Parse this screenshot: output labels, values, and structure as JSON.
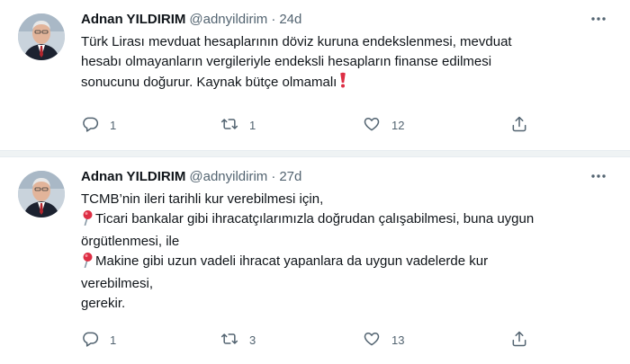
{
  "tweets": [
    {
      "display_name": "Adnan YILDIRIM",
      "handle": "@adnyildirim",
      "separator": "·",
      "time": "24d",
      "text_lines": [
        "Türk Lirası mevduat hesaplarının döviz kuruna endekslenmesi, mevduat",
        "hesabı olmayanların vergileriyle endeksli hesapların finanse edilmesi",
        "sonucunu doğurur. Kaynak bütçe olmamalı"
      ],
      "emoji_icon": "red-exclamation-icon",
      "replies": "1",
      "retweets": "1",
      "likes": "12"
    },
    {
      "display_name": "Adnan YILDIRIM",
      "handle": "@adnyildirim",
      "separator": "·",
      "time": "27d",
      "text_lines": [
        "TCMB’nin ileri tarihli kur verebilmesi için,",
        "Ticari bankalar gibi ihracatçılarımızla doğrudan çalışabilmesi, buna uygun",
        "örgütlenmesi, ile",
        "Makine gibi uzun vadeli ihracat yapanlara da uygun vadelerde kur",
        "verebilmesi,",
        "gerekir."
      ],
      "bullet_icon": "round-pushpin-icon",
      "replies": "1",
      "retweets": "3",
      "likes": "13"
    }
  ],
  "colors": {
    "text": "#0f1419",
    "secondary": "#536471",
    "separator_bg": "#eff3f4",
    "emoji_red": "#dd2e44"
  },
  "icons": [
    "avatar",
    "more-icon",
    "reply-icon",
    "retweet-icon",
    "like-icon",
    "share-icon"
  ]
}
